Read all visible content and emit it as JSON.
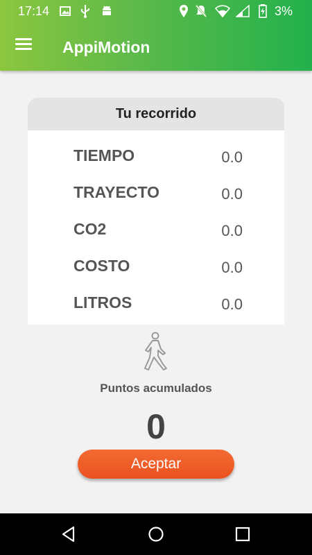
{
  "status_bar": {
    "time": "17:14",
    "battery": "3%",
    "icons": [
      "image-icon",
      "usb-icon",
      "android-icon",
      "location-icon",
      "mute-icon",
      "wifi-icon",
      "signal-icon",
      "battery-charging-icon"
    ]
  },
  "app_bar": {
    "title": "AppiMotion",
    "menu_icon": "hamburger-menu-icon"
  },
  "card": {
    "title": "Tu recorrido",
    "rows": [
      {
        "label": "TIEMPO",
        "value": "0.0"
      },
      {
        "label": "TRAYECTO",
        "value": "0.0"
      },
      {
        "label": "CO2",
        "value": "0.0"
      },
      {
        "label": "COSTO",
        "value": "0.0"
      },
      {
        "label": "LITROS",
        "value": "0.0"
      }
    ]
  },
  "activity_icon": "walking-person-icon",
  "points": {
    "label": "Puntos acumulados",
    "value": "0"
  },
  "accept_button": {
    "label": "Aceptar"
  },
  "nav_bar": {
    "buttons": [
      "back-icon",
      "home-icon",
      "recents-icon"
    ]
  },
  "colors": {
    "app_bar_start": "#8cc63f",
    "app_bar_end": "#22b14c",
    "accent_button": "#ee5a24",
    "background": "#f2f2f2"
  }
}
